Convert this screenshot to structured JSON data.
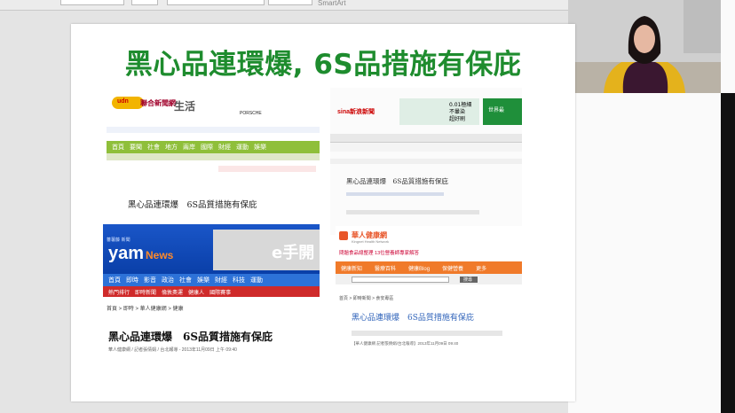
{
  "toolbar": {
    "smartart_label": "SmartArt"
  },
  "slide": {
    "title": "黑心品連環爆, 6S品措施有保庇"
  },
  "shots": {
    "udn": {
      "logo": "聯合新聞網",
      "logo_badge": "udn",
      "section": "生活",
      "sponsor": "PORSCHE",
      "nav": [
        "首頁",
        "要聞",
        "社會",
        "地方",
        "兩岸",
        "國際",
        "財經",
        "運動",
        "娛樂"
      ],
      "headline": "黑心品連環爆　6S品質措施有保庇"
    },
    "sina": {
      "logo": "sina新浪新聞",
      "ad_lines": [
        "0.01極細",
        "不暈染",
        "超好刷"
      ],
      "ad_side": "世界最",
      "headline": "黑心品連環爆　6S品質措施有保庇"
    },
    "yam": {
      "logo": "yam",
      "logo_suffix": "News",
      "logo_tag": "蕃薯藤 新聞",
      "banner": "e手開",
      "nav": [
        "首頁",
        "即時",
        "影音",
        "政治",
        "社會",
        "娛樂",
        "財經",
        "科技",
        "運動"
      ],
      "subnav": [
        "熱門排行",
        "即時新聞",
        "倫敦奧運",
        "健康人",
        "國際賽事"
      ],
      "breadcrumb": "首頁 > 即時 > 華人健康網 > 健康",
      "headline": "黑心品連環爆　6S品質措施有保庇",
      "byline": "華人健康網 / 記者張倩娟 / 台北報導 - 2013年11月09日 上午 09:40"
    },
    "kingnet": {
      "logo": "華人健康網",
      "logo_sub": "Kingnet Health Network",
      "notice": "問題食品總整理 13位營養師專家解答",
      "nav": [
        "健康新知",
        "醫療百科",
        "健康Blog",
        "保健營養",
        "更多"
      ],
      "search_btn": "搜尋",
      "breadcrumb": "首頁 > 即時新聞 > 食安專區",
      "headline": "黑心品連環爆　6S品質措施有保庇",
      "meta": "【華人健康網 記者張倩娟/台北報導】2013年11月09日 09:40"
    }
  }
}
